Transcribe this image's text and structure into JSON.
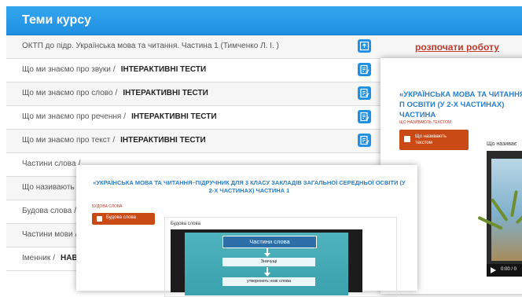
{
  "panel": {
    "title": "Теми курсу"
  },
  "rows": [
    {
      "text": "ОКТП до підр. Українська мова та читання. Частина 1 (Тимченко Л. І. )",
      "sep": "",
      "tag": "",
      "has_icon": true,
      "action": "розпочати роботу"
    },
    {
      "text": "Що ми знаємо про звуки",
      "sep": "/",
      "tag": "ІНТЕРАКТИВНІ ТЕСТИ",
      "has_icon": true
    },
    {
      "text": "Що ми знаємо про слово",
      "sep": "/",
      "tag": "ІНТЕРАКТИВНІ ТЕСТИ",
      "has_icon": true
    },
    {
      "text": "Що ми знаємо про речення",
      "sep": "/",
      "tag": "ІНТЕРАКТИВНІ ТЕСТИ",
      "has_icon": true
    },
    {
      "text": "Що ми знаємо про текст",
      "sep": "/",
      "tag": "ІНТЕРАКТИВНІ ТЕСТИ",
      "has_icon": true
    },
    {
      "text": "Частини слова",
      "sep": "/",
      "tag": "",
      "has_icon": false
    },
    {
      "text": "Що називають те",
      "sep": "",
      "tag": "",
      "has_icon": false
    },
    {
      "text": "Будова слова",
      "sep": "/",
      "tag": "",
      "has_icon": false
    },
    {
      "text": "Частини мови",
      "sep": "/",
      "tag": "",
      "has_icon": false
    },
    {
      "text": "Іменник",
      "sep": "/",
      "tag": "НАВ",
      "has_icon": false
    }
  ],
  "popup_back": {
    "title": "«УКРАЇНСЬКА МОВА ТА ЧИТАННЯ–П ОСВІТИ (У 2-Х ЧАСТИНАХ) ЧАСТИНА",
    "small_label": "ЩО НАЗИВАЮТЬ ТЕКСТОМ",
    "button_label": "Що називають текстом",
    "video_label": "Що називає",
    "time": "0:00 / 0"
  },
  "popup_front": {
    "title": "«УКРАЇНСЬКА МОВА ТА ЧИТАННЯ–ПІДРУЧНИК ДЛЯ 3 КЛАСУ ЗАКЛАДІВ ЗАГАЛЬНОЇ СЕРЕДНЬОЇ ОСВІТИ (У 2-Х ЧАСТИНАХ) ЧАСТИНА 1",
    "small_label": "БУДОВА СЛОВА",
    "button_label": "Будова слова",
    "video_label": "Будова слова",
    "diagram_head": "Частини слова",
    "diagram_items": [
      "Значущі",
      "утворюють нові слова"
    ]
  },
  "colors": {
    "header": "#1f8fe0",
    "action": "#c0392b",
    "button": "#c94a15",
    "popup_title": "#2a7ec8"
  }
}
